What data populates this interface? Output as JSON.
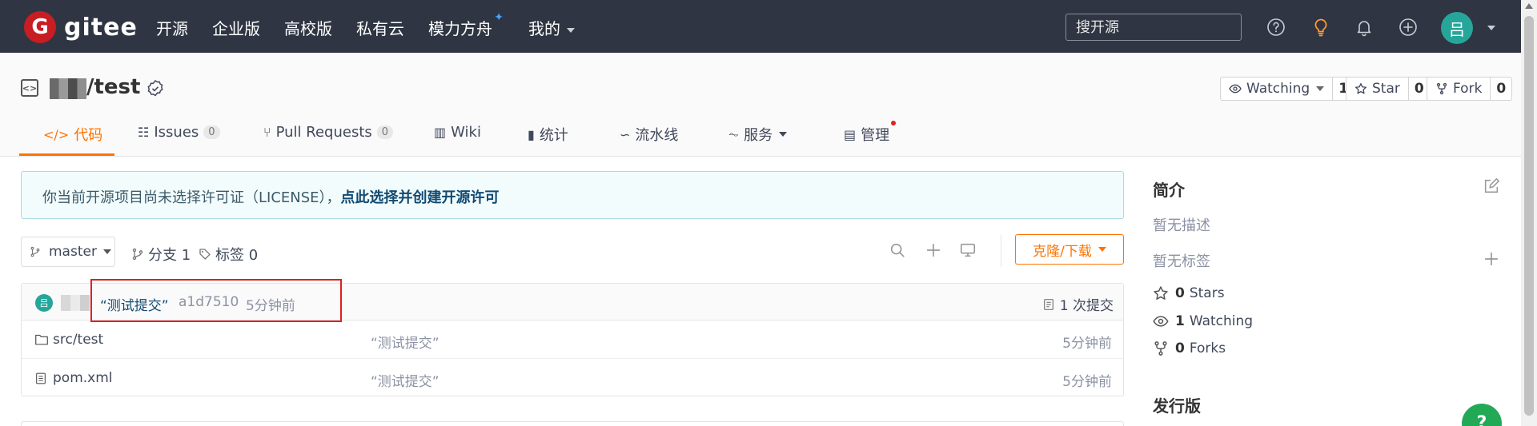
{
  "nav": {
    "logo_letter": "G",
    "logo_text": "gitee",
    "items": [
      "开源",
      "企业版",
      "高校版",
      "私有云",
      "模力方舟",
      "我的"
    ],
    "star_mark": "✦",
    "search_placeholder": "搜开源",
    "avatar_letter": "吕",
    "icons": [
      "help-circle-icon",
      "lightbulb-icon",
      "bell-icon",
      "plus-circle-icon"
    ]
  },
  "repo": {
    "name": "/test",
    "code_icon_glyph": "<>",
    "actions": [
      {
        "label": "Watching",
        "count": "1",
        "icon": "eye-icon"
      },
      {
        "label": "Star",
        "count": "0",
        "icon": "star-icon"
      },
      {
        "label": "Fork",
        "count": "0",
        "icon": "fork-icon"
      }
    ],
    "tabs": [
      {
        "label": "代码",
        "glyph": "</>",
        "active": true
      },
      {
        "label": "Issues",
        "count": "0",
        "glyph": "☷"
      },
      {
        "label": "Pull Requests",
        "count": "0",
        "glyph": "⑂"
      },
      {
        "label": "Wiki",
        "glyph": "▥"
      },
      {
        "label": "统计",
        "glyph": "▮"
      },
      {
        "label": "流水线",
        "glyph": "∽"
      },
      {
        "label": "服务",
        "glyph": "⏦"
      },
      {
        "label": "管理",
        "glyph": "▤"
      }
    ]
  },
  "license": {
    "text": "你当前开源项目尚未选择许可证（LICENSE），",
    "link": "点此选择并创建开源许可"
  },
  "branch": {
    "current": "master",
    "branches_label": "分支 1",
    "tags_label": "标签 0",
    "clone_label": "克隆/下载"
  },
  "commit": {
    "avatar_letter": "吕",
    "message": "“测试提交”",
    "hash": "a1d7510",
    "time": "5分钟前",
    "count_label": "1 次提交"
  },
  "files": [
    {
      "name": "src/test",
      "type": "folder",
      "message": "“测试提交”",
      "time": "5分钟前"
    },
    {
      "name": "pom.xml",
      "type": "file",
      "message": "“测试提交”",
      "time": "5分钟前"
    }
  ],
  "sidebar": {
    "intro_title": "简介",
    "no_desc": "暂无描述",
    "no_tags": "暂无标签",
    "stats": [
      {
        "count": "0",
        "label": "Stars",
        "icon": "star-icon"
      },
      {
        "count": "1",
        "label": "Watching",
        "icon": "eye-icon"
      },
      {
        "count": "0",
        "label": "Forks",
        "icon": "fork-icon"
      }
    ],
    "releases_title": "发行版",
    "help_label": "?"
  },
  "colors": {
    "nav_bg": "#2f3542",
    "accent": "#fe7300",
    "logo_red": "#c71d23",
    "avatar_teal": "#26a69a",
    "highlight_red": "#e0201e"
  }
}
